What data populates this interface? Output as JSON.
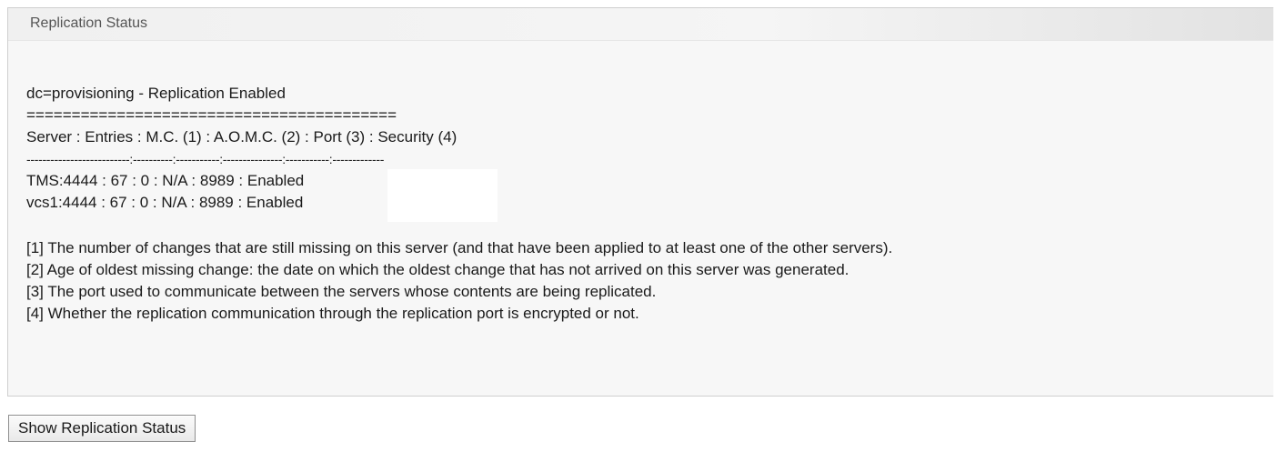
{
  "panel": {
    "title": "Replication Status"
  },
  "content": {
    "heading": "dc=provisioning - Replication Enabled",
    "separator": "=========================================",
    "columns_line": "Server : Entries : M.C. (1) : A.O.M.C. (2) : Port (3) : Security (4)",
    "dash_line": "--------------------------:----------:-----------:---------------:-----------:-------------",
    "rows": [
      "TMS:4444 : 67 : 0 : N/A : 8989 : Enabled",
      "vcs1:4444 : 67 : 0 : N/A : 8989 : Enabled"
    ],
    "notes": [
      "[1] The number of changes that are still missing on this server (and that have been applied to at least one of the other servers).",
      "[2] Age of oldest missing change: the date on which the oldest change that has not arrived on this server was generated.",
      "[3] The port used to communicate between the servers whose contents are being replicated.",
      "[4] Whether the replication communication through the replication port is encrypted or not."
    ]
  },
  "actions": {
    "show_button_label": "Show Replication Status"
  }
}
